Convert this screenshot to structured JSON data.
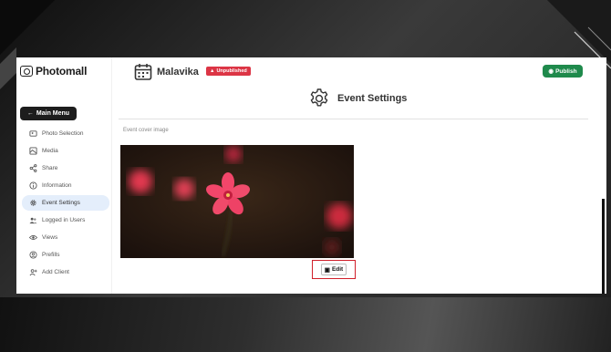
{
  "brand": {
    "name": "Photomall"
  },
  "sidebar": {
    "main_menu_label": "Main Menu",
    "items": [
      {
        "label": "Photo Selection",
        "icon": "photo-selection-icon",
        "active": false
      },
      {
        "label": "Media",
        "icon": "media-icon",
        "active": false
      },
      {
        "label": "Share",
        "icon": "share-icon",
        "active": false
      },
      {
        "label": "Information",
        "icon": "info-icon",
        "active": false
      },
      {
        "label": "Event Settings",
        "icon": "gear-icon",
        "active": true
      },
      {
        "label": "Logged in Users",
        "icon": "users-icon",
        "active": false
      },
      {
        "label": "Views",
        "icon": "eye-icon",
        "active": false
      },
      {
        "label": "Prefills",
        "icon": "user-circle-icon",
        "active": false
      },
      {
        "label": "Add Client",
        "icon": "add-client-icon",
        "active": false
      }
    ]
  },
  "header": {
    "event_name": "Malavika",
    "status_badge": "Unpublished",
    "publish_label": "Publish",
    "page_title": "Event Settings"
  },
  "cover": {
    "label": "Event cover image",
    "edit_label": "Edit"
  },
  "colors": {
    "accent_green": "#1f8a4c",
    "badge_red": "#dc3545",
    "highlight_red": "#d01f2a",
    "active_nav_bg": "#e4eefb"
  }
}
